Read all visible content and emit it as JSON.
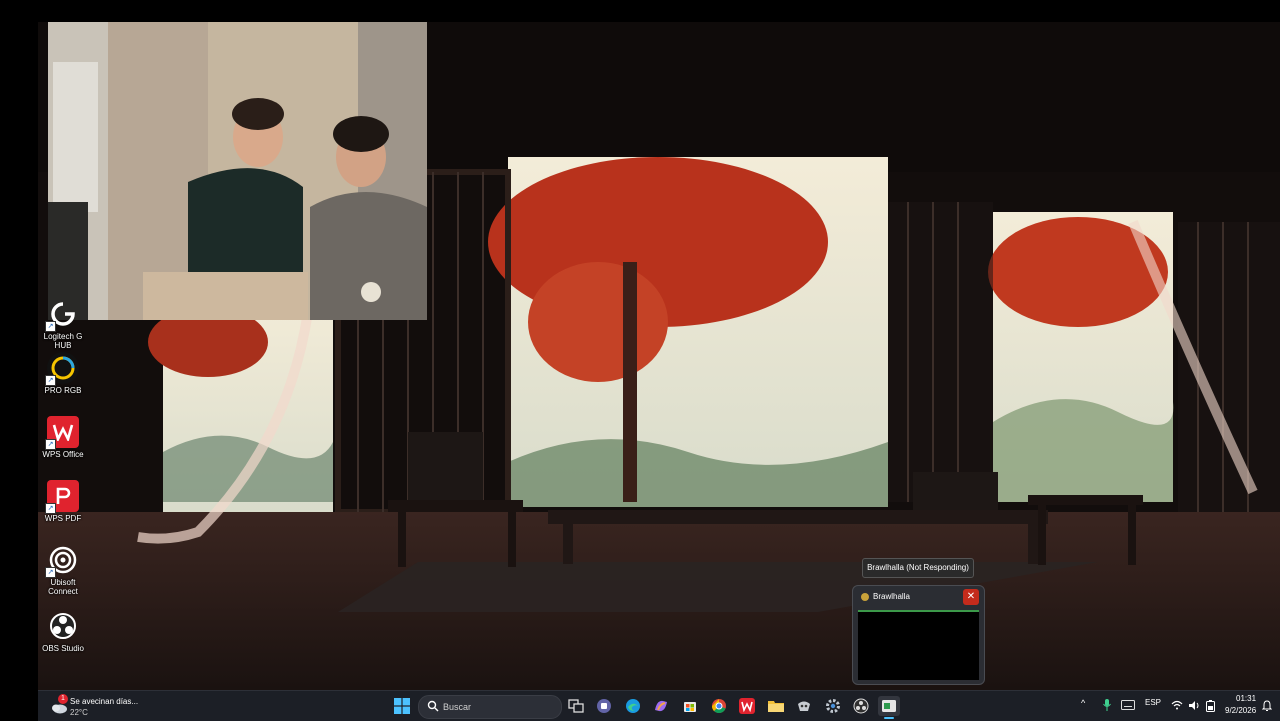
{
  "desktop_icons": [
    {
      "label": "Logitech G HUB",
      "icon": "logitech-g-hub-icon"
    },
    {
      "label": "PRO RGB",
      "icon": "pro-rgb-icon"
    },
    {
      "label": "WPS Office",
      "icon": "wps-office-icon"
    },
    {
      "label": "WPS PDF",
      "icon": "wps-pdf-icon"
    },
    {
      "label": "Ubisoft Connect",
      "icon": "ubisoft-connect-icon"
    },
    {
      "label": "OBS Studio",
      "icon": "obs-studio-icon"
    }
  ],
  "taskbar": {
    "weather": {
      "title": "Se avecinan días...",
      "temp": "22°C",
      "badge": "1"
    },
    "search_placeholder": "Buscar",
    "pinned": [
      "start-icon",
      "task-view-icon",
      "teams-icon",
      "edge-icon",
      "copilot-icon",
      "store-icon",
      "chrome-icon",
      "wps-icon",
      "file-explorer-icon",
      "app-icon",
      "settings-icon",
      "obs-icon",
      "active-app-icon"
    ],
    "tray": {
      "language": "ESP",
      "time": "01:31",
      "date": "9/2/2026"
    }
  },
  "popup": {
    "tooltip": "Brawlhalla (Not Responding)",
    "window_title": "Brawlhalla",
    "close_symbol": "✕"
  },
  "colors": {
    "taskbar_bg": "#1c1f26",
    "accent_red": "#c42b1c",
    "wps_red": "#e0232e"
  }
}
